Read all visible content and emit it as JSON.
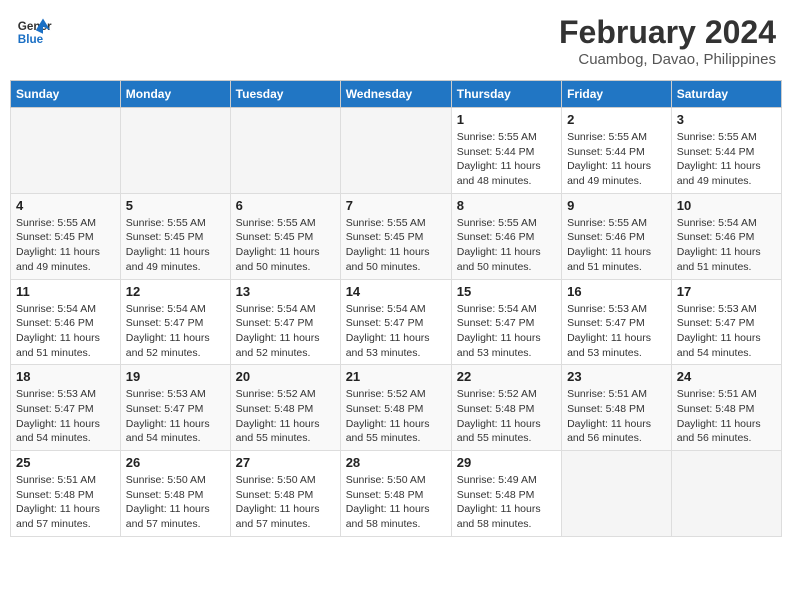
{
  "header": {
    "logo_line1": "General",
    "logo_line2": "Blue",
    "month_year": "February 2024",
    "location": "Cuambog, Davao, Philippines"
  },
  "days_of_week": [
    "Sunday",
    "Monday",
    "Tuesday",
    "Wednesday",
    "Thursday",
    "Friday",
    "Saturday"
  ],
  "weeks": [
    [
      {
        "num": "",
        "info": ""
      },
      {
        "num": "",
        "info": ""
      },
      {
        "num": "",
        "info": ""
      },
      {
        "num": "",
        "info": ""
      },
      {
        "num": "1",
        "info": "Sunrise: 5:55 AM\nSunset: 5:44 PM\nDaylight: 11 hours\nand 48 minutes."
      },
      {
        "num": "2",
        "info": "Sunrise: 5:55 AM\nSunset: 5:44 PM\nDaylight: 11 hours\nand 49 minutes."
      },
      {
        "num": "3",
        "info": "Sunrise: 5:55 AM\nSunset: 5:44 PM\nDaylight: 11 hours\nand 49 minutes."
      }
    ],
    [
      {
        "num": "4",
        "info": "Sunrise: 5:55 AM\nSunset: 5:45 PM\nDaylight: 11 hours\nand 49 minutes."
      },
      {
        "num": "5",
        "info": "Sunrise: 5:55 AM\nSunset: 5:45 PM\nDaylight: 11 hours\nand 49 minutes."
      },
      {
        "num": "6",
        "info": "Sunrise: 5:55 AM\nSunset: 5:45 PM\nDaylight: 11 hours\nand 50 minutes."
      },
      {
        "num": "7",
        "info": "Sunrise: 5:55 AM\nSunset: 5:45 PM\nDaylight: 11 hours\nand 50 minutes."
      },
      {
        "num": "8",
        "info": "Sunrise: 5:55 AM\nSunset: 5:46 PM\nDaylight: 11 hours\nand 50 minutes."
      },
      {
        "num": "9",
        "info": "Sunrise: 5:55 AM\nSunset: 5:46 PM\nDaylight: 11 hours\nand 51 minutes."
      },
      {
        "num": "10",
        "info": "Sunrise: 5:54 AM\nSunset: 5:46 PM\nDaylight: 11 hours\nand 51 minutes."
      }
    ],
    [
      {
        "num": "11",
        "info": "Sunrise: 5:54 AM\nSunset: 5:46 PM\nDaylight: 11 hours\nand 51 minutes."
      },
      {
        "num": "12",
        "info": "Sunrise: 5:54 AM\nSunset: 5:47 PM\nDaylight: 11 hours\nand 52 minutes."
      },
      {
        "num": "13",
        "info": "Sunrise: 5:54 AM\nSunset: 5:47 PM\nDaylight: 11 hours\nand 52 minutes."
      },
      {
        "num": "14",
        "info": "Sunrise: 5:54 AM\nSunset: 5:47 PM\nDaylight: 11 hours\nand 53 minutes."
      },
      {
        "num": "15",
        "info": "Sunrise: 5:54 AM\nSunset: 5:47 PM\nDaylight: 11 hours\nand 53 minutes."
      },
      {
        "num": "16",
        "info": "Sunrise: 5:53 AM\nSunset: 5:47 PM\nDaylight: 11 hours\nand 53 minutes."
      },
      {
        "num": "17",
        "info": "Sunrise: 5:53 AM\nSunset: 5:47 PM\nDaylight: 11 hours\nand 54 minutes."
      }
    ],
    [
      {
        "num": "18",
        "info": "Sunrise: 5:53 AM\nSunset: 5:47 PM\nDaylight: 11 hours\nand 54 minutes."
      },
      {
        "num": "19",
        "info": "Sunrise: 5:53 AM\nSunset: 5:47 PM\nDaylight: 11 hours\nand 54 minutes."
      },
      {
        "num": "20",
        "info": "Sunrise: 5:52 AM\nSunset: 5:48 PM\nDaylight: 11 hours\nand 55 minutes."
      },
      {
        "num": "21",
        "info": "Sunrise: 5:52 AM\nSunset: 5:48 PM\nDaylight: 11 hours\nand 55 minutes."
      },
      {
        "num": "22",
        "info": "Sunrise: 5:52 AM\nSunset: 5:48 PM\nDaylight: 11 hours\nand 55 minutes."
      },
      {
        "num": "23",
        "info": "Sunrise: 5:51 AM\nSunset: 5:48 PM\nDaylight: 11 hours\nand 56 minutes."
      },
      {
        "num": "24",
        "info": "Sunrise: 5:51 AM\nSunset: 5:48 PM\nDaylight: 11 hours\nand 56 minutes."
      }
    ],
    [
      {
        "num": "25",
        "info": "Sunrise: 5:51 AM\nSunset: 5:48 PM\nDaylight: 11 hours\nand 57 minutes."
      },
      {
        "num": "26",
        "info": "Sunrise: 5:50 AM\nSunset: 5:48 PM\nDaylight: 11 hours\nand 57 minutes."
      },
      {
        "num": "27",
        "info": "Sunrise: 5:50 AM\nSunset: 5:48 PM\nDaylight: 11 hours\nand 57 minutes."
      },
      {
        "num": "28",
        "info": "Sunrise: 5:50 AM\nSunset: 5:48 PM\nDaylight: 11 hours\nand 58 minutes."
      },
      {
        "num": "29",
        "info": "Sunrise: 5:49 AM\nSunset: 5:48 PM\nDaylight: 11 hours\nand 58 minutes."
      },
      {
        "num": "",
        "info": ""
      },
      {
        "num": "",
        "info": ""
      }
    ]
  ]
}
